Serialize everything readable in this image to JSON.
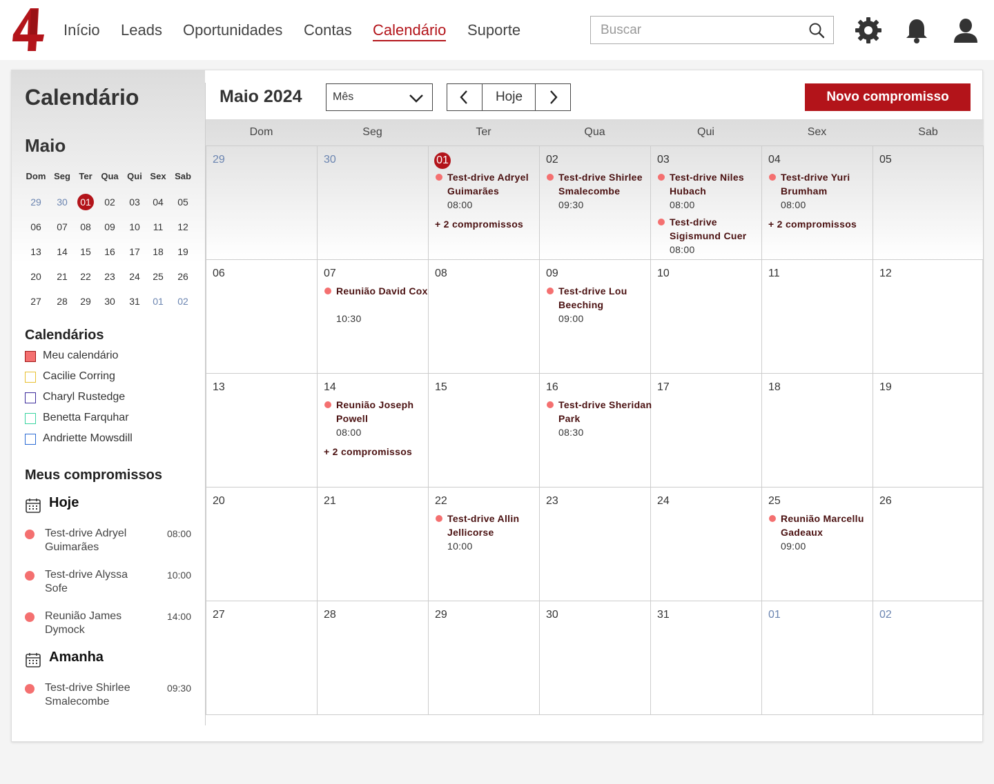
{
  "nav": {
    "items": [
      "Início",
      "Leads",
      "Oportunidades",
      "Contas",
      "Calendário",
      "Suporte"
    ],
    "active": "Calendário",
    "search_placeholder": "Buscar",
    "accent": "#b3141a"
  },
  "sidebar": {
    "title": "Calendário",
    "month": "Maio",
    "weekdays": [
      "Dom",
      "Seg",
      "Ter",
      "Qua",
      "Qui",
      "Sex",
      "Sab"
    ],
    "weeks": [
      [
        "29",
        "30",
        "01",
        "02",
        "03",
        "04",
        "05"
      ],
      [
        "06",
        "07",
        "08",
        "09",
        "10",
        "11",
        "12"
      ],
      [
        "13",
        "14",
        "15",
        "16",
        "17",
        "18",
        "19"
      ],
      [
        "20",
        "21",
        "22",
        "23",
        "24",
        "25",
        "26"
      ],
      [
        "27",
        "28",
        "29",
        "30",
        "31",
        "01",
        "02"
      ]
    ],
    "calendars_heading": "Calendários",
    "calendars": [
      {
        "name": "Meu calendário",
        "color": "#e84545",
        "filled": true
      },
      {
        "name": "Cacilie Corring",
        "color": "#e8c030",
        "filled": false
      },
      {
        "name": "Charyl Rustedge",
        "color": "#3b2a9a",
        "filled": false
      },
      {
        "name": "Benetta Farquhar",
        "color": "#38d4a0",
        "filled": false
      },
      {
        "name": "Andriette Mowsdill",
        "color": "#2a6ad4",
        "filled": false
      }
    ],
    "appointments_heading": "Meus compromissos",
    "groups": [
      {
        "title": "Hoje",
        "items": [
          {
            "name": "Test-drive Adryel Guimarães",
            "time": "08:00"
          },
          {
            "name": "Test-drive Alyssa Sofe",
            "time": "10:00"
          },
          {
            "name": "Reunião James Dymock",
            "time": "14:00"
          }
        ]
      },
      {
        "title": "Amanha",
        "items": [
          {
            "name": "Test-drive Shirlee Smalecombe",
            "time": "09:30"
          }
        ]
      }
    ]
  },
  "main": {
    "title": "Maio 2024",
    "view": "Mês",
    "today_label": "Hoje",
    "new_button": "Novo compromisso",
    "weekdays": [
      "Dom",
      "Seg",
      "Ter",
      "Qua",
      "Qui",
      "Sex",
      "Sab"
    ],
    "weeks": [
      [
        {
          "day": "29",
          "other": true
        },
        {
          "day": "30",
          "other": true
        },
        {
          "day": "01",
          "today": true,
          "events": [
            {
              "title": "Test-drive Adryel Guimarães",
              "time": "08:00"
            }
          ],
          "more": "+ 2 compromissos"
        },
        {
          "day": "02",
          "events": [
            {
              "title": "Test-drive Shirlee Smalecombe",
              "time": "09:30"
            }
          ]
        },
        {
          "day": "03",
          "events": [
            {
              "title": "Test-drive Niles Hubach",
              "time": "08:00"
            },
            {
              "title": "Test-drive Sigismund Cuer",
              "time": "08:00"
            }
          ]
        },
        {
          "day": "04",
          "events": [
            {
              "title": "Test-drive Yuri Brumham",
              "time": "08:00"
            }
          ],
          "more": "+ 2 compromissos"
        },
        {
          "day": "05"
        }
      ],
      [
        {
          "day": "06"
        },
        {
          "day": "07",
          "events": [
            {
              "title": "Reunião David Cox",
              "time": "10:30"
            }
          ]
        },
        {
          "day": "08"
        },
        {
          "day": "09",
          "events": [
            {
              "title": "Test-drive Lou Beeching",
              "time": "09:00"
            }
          ]
        },
        {
          "day": "10"
        },
        {
          "day": "11"
        },
        {
          "day": "12"
        }
      ],
      [
        {
          "day": "13"
        },
        {
          "day": "14",
          "events": [
            {
              "title": "Reunião Joseph Powell",
              "time": "08:00"
            }
          ],
          "more": "+ 2 compromissos"
        },
        {
          "day": "15"
        },
        {
          "day": "16",
          "events": [
            {
              "title": "Test-drive Sheridan Park",
              "time": "08:30"
            }
          ]
        },
        {
          "day": "17"
        },
        {
          "day": "18"
        },
        {
          "day": "19"
        }
      ],
      [
        {
          "day": "20"
        },
        {
          "day": "21"
        },
        {
          "day": "22",
          "events": [
            {
              "title": "Test-drive Allin Jellicorse",
              "time": "10:00"
            }
          ]
        },
        {
          "day": "23"
        },
        {
          "day": "24"
        },
        {
          "day": "25",
          "events": [
            {
              "title": "Reunião Marcellu Gadeaux",
              "time": "09:00"
            }
          ]
        },
        {
          "day": "26"
        }
      ],
      [
        {
          "day": "27"
        },
        {
          "day": "28"
        },
        {
          "day": "29"
        },
        {
          "day": "30"
        },
        {
          "day": "31"
        },
        {
          "day": "01",
          "other": true
        },
        {
          "day": "02",
          "other": true
        }
      ]
    ]
  }
}
